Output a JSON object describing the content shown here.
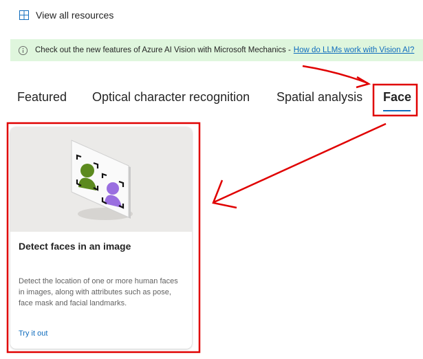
{
  "top_link": {
    "label": "View all resources",
    "icon": "grid-icon"
  },
  "banner": {
    "text": "Check out the new features of Azure AI Vision with Microsoft Mechanics -",
    "link": "How do LLMs work with Vision AI?",
    "icon": "info-icon",
    "background": "#dff6dd"
  },
  "tabs": [
    {
      "label": "Featured",
      "active": false
    },
    {
      "label": "Optical character recognition",
      "active": false
    },
    {
      "label": "Spatial analysis",
      "active": false
    },
    {
      "label": "Face",
      "active": true
    }
  ],
  "card": {
    "title": "Detect faces in an image",
    "description": "Detect the location of one or more human faces in images, along with attributes such as pose, face mask and facial landmarks.",
    "link": "Try it out",
    "illustration": "face-detection-illustration"
  },
  "colors": {
    "accent": "#0f6cbd",
    "annotation": "#e00000",
    "face_green": "#5c8a1e",
    "face_purple": "#9a6fe0"
  }
}
